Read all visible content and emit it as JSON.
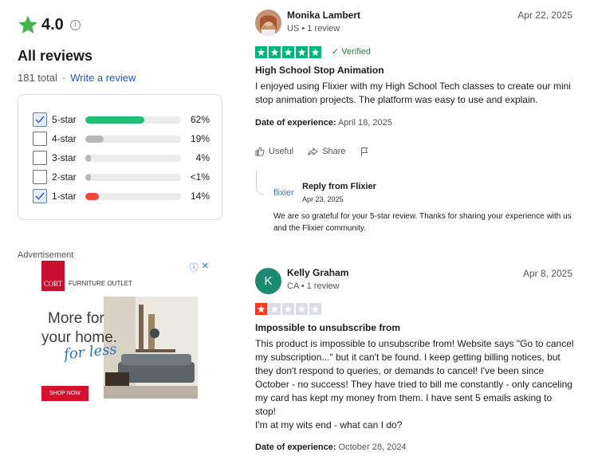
{
  "summary": {
    "rating": "4.0",
    "heading": "All reviews",
    "total": "181 total",
    "write_review": "Write a review"
  },
  "filters": [
    {
      "label": "5-star",
      "pct_text": "62%",
      "pct": 62,
      "checked": true,
      "color": "#1fbf7a"
    },
    {
      "label": "4-star",
      "pct_text": "19%",
      "pct": 19,
      "checked": false,
      "color": "#b8b8b8"
    },
    {
      "label": "3-star",
      "pct_text": "4%",
      "pct": 4,
      "checked": false,
      "color": "#b8b8b8"
    },
    {
      "label": "2-star",
      "pct_text": "<1%",
      "pct": 1,
      "checked": false,
      "color": "#b8b8b8"
    },
    {
      "label": "1-star",
      "pct_text": "14%",
      "pct": 14,
      "checked": true,
      "color": "#f2483b"
    }
  ],
  "ad": {
    "label": "Advertisement",
    "logo": "CORT",
    "brand": "FURNITURE OUTLET",
    "line1": "More for",
    "line2": "your home.",
    "line3": "for less",
    "cta": "SHOP NOW"
  },
  "reviews": [
    {
      "name": "Monika Lambert",
      "meta": "US • 1 review",
      "date": "Apr 22, 2025",
      "stars": 5,
      "verified": "Verified",
      "title": "High School Stop Animation",
      "body": [
        "I enjoyed using Flixier with my High School Tech classes to create our mini stop animation projects. The platform was easy to use and explain."
      ],
      "doe_label": "Date of experience:",
      "doe_value": "April 18, 2025",
      "useful": "Useful",
      "share": "Share",
      "reply": {
        "logo": "flixier",
        "from": "Reply from Flixier",
        "date": "Apr 23, 2025",
        "body": "We are so grateful for your 5-star review. Thanks for sharing your experience with us and the Flixier community."
      }
    },
    {
      "name": "Kelly Graham",
      "initial": "K",
      "meta": "CA • 1 review",
      "date": "Apr 8, 2025",
      "stars": 1,
      "title": "Impossible to unsubscribe from",
      "body": [
        "This product is impossible to unsubscribe from! Website says \"Go to cancel my subscription...\" but it can't be found. I keep getting billing notices, but they don't respond to queries, or demands to cancel! I've been since October - no success! They have tried to bill me constantly - only canceling my card has kept my money from them. I have sent 5 emails asking to stop!",
        "I'm at my wits end - what can I do?"
      ],
      "doe_label": "Date of experience:",
      "doe_value": "October 28, 2024"
    }
  ],
  "colors": {
    "star_green": "#00b67a",
    "star_red": "#ff3722",
    "star_empty": "#dcdce6",
    "link": "#1a56c9"
  }
}
